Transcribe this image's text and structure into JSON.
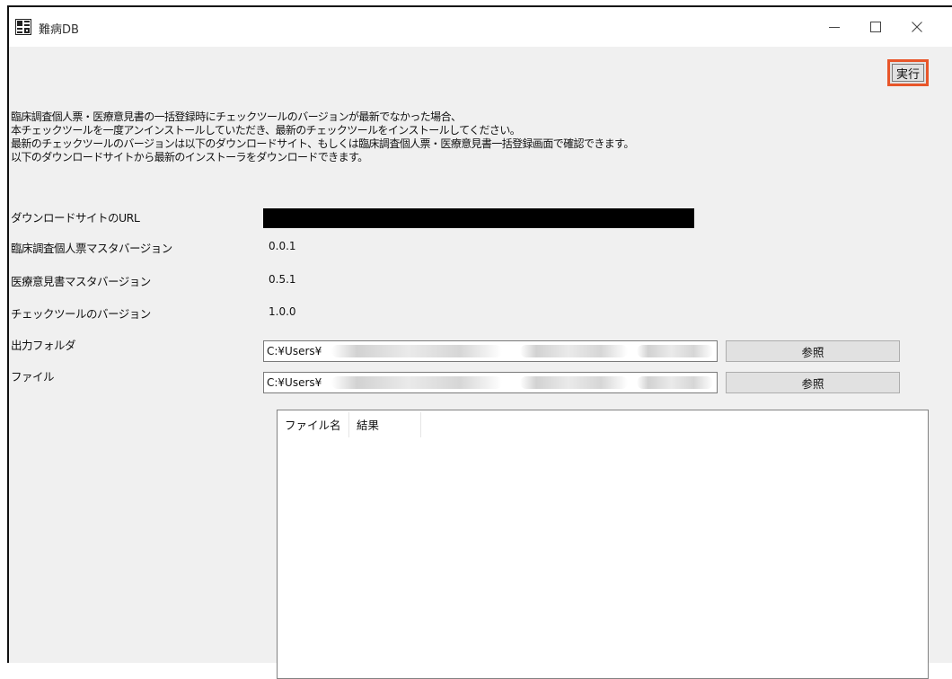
{
  "window": {
    "title": "難病DB",
    "app_icon": "app-grid-icon",
    "controls": [
      "minimize-icon",
      "maximize-icon",
      "close-icon"
    ]
  },
  "toolbar": {
    "run_label": "実行",
    "run_highlight_color": "#e8562a"
  },
  "description": {
    "line1": "臨床調査個人票・医療意見書の一括登録時にチェックツールのバージョンが最新でなかった場合、",
    "line2": "本チェックツールを一度アンインストールしていただき、最新のチェックツールをインストールしてください。",
    "line3": "最新のチェックツールのバージョンは以下のダウンロードサイト、もしくは臨床調査個人票・医療意見書一括登録画面で確認できます。",
    "line4": "以下のダウンロードサイトから最新のインストーラをダウンロードできます。"
  },
  "info": {
    "download_url_label": "ダウンロードサイトのURL",
    "clinical_master_label": "臨床調査個人票マスタバージョン",
    "clinical_master_value": "0.0.1",
    "medical_master_label": "医療意見書マスタバージョン",
    "medical_master_value": "0.5.1",
    "tool_version_label": "チェックツールのバージョン",
    "tool_version_value": "1.0.0"
  },
  "output_folder": {
    "label": "出力フォルダ",
    "value": "C:¥Users¥",
    "browse_label": "参照"
  },
  "file": {
    "label": "ファイル",
    "value": "C:¥Users¥",
    "browse_label": "参照"
  },
  "results_table": {
    "columns": [
      "ファイル名",
      "結果"
    ]
  }
}
